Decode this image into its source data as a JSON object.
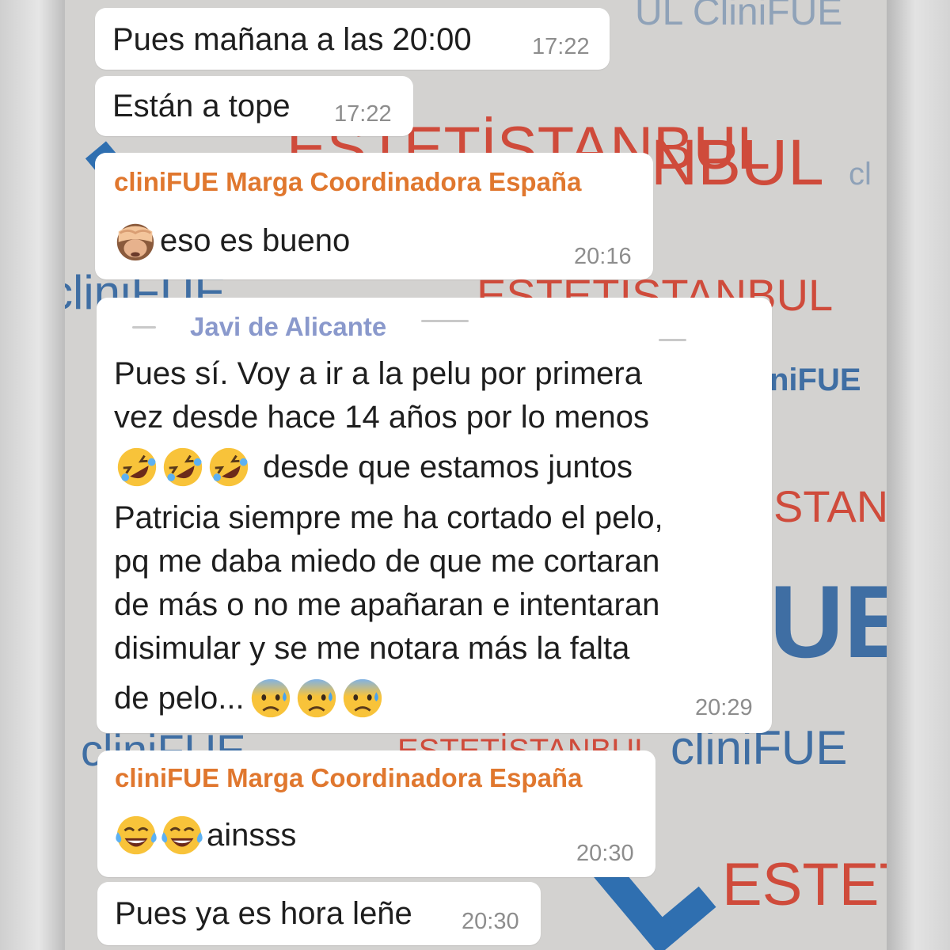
{
  "background": {
    "watermark_brand": "cliniFUE",
    "watermark_brand_short": "cliniFUE",
    "watermark_fragment_ue": "UE",
    "watermark_fragment_nifue": "niFUE",
    "watermark_clinic": "ESTETİSTANBUL",
    "watermark_nbul": "NBUL",
    "watermark_stan": "STAN",
    "watermark_este": "ESTET",
    "watermark_cl": "cl",
    "watermark_top": "UL  CliniFUE",
    "colors": {
      "blue": "#3f6ea3",
      "orange": "#cf4b3b"
    }
  },
  "messages": [
    {
      "text": "Pues mañana a las 20:00",
      "time": "17:22"
    },
    {
      "text": "Están a tope",
      "time": "17:22"
    },
    {
      "sender": "cliniFUE Marga Coordinadora España",
      "sender_color": "#e0772e",
      "emoji": "see-no-evil-monkey",
      "text": "eso es bueno",
      "time": "20:16"
    },
    {
      "sender": "Javi de Alicante",
      "sender_color": "#8a99cc",
      "lines": [
        "Pues sí. Voy a ir a la pelu por primera",
        "vez desde hace 14 años por lo menos",
        "desde que estamos juntos",
        "Patricia siempre me ha cortado el pelo,",
        "pq me daba miedo de que me cortaran",
        "de más o no me apañaran e intentaran",
        "disimular y se me notara más la falta",
        "de pelo..."
      ],
      "line3_emojis": [
        "rolling-on-floor-laughing",
        "rolling-on-floor-laughing",
        "rolling-on-floor-laughing"
      ],
      "last_line_emojis": [
        "anxious-face-with-sweat",
        "anxious-face-with-sweat",
        "anxious-face-with-sweat"
      ],
      "time": "20:29"
    },
    {
      "sender": "cliniFUE Marga Coordinadora España",
      "sender_color": "#e0772e",
      "emojis": [
        "face-with-tears-of-joy",
        "face-with-tears-of-joy"
      ],
      "text": "ainsss",
      "time": "20:30"
    },
    {
      "text": "Pues ya es hora leñe",
      "time": "20:30"
    }
  ]
}
